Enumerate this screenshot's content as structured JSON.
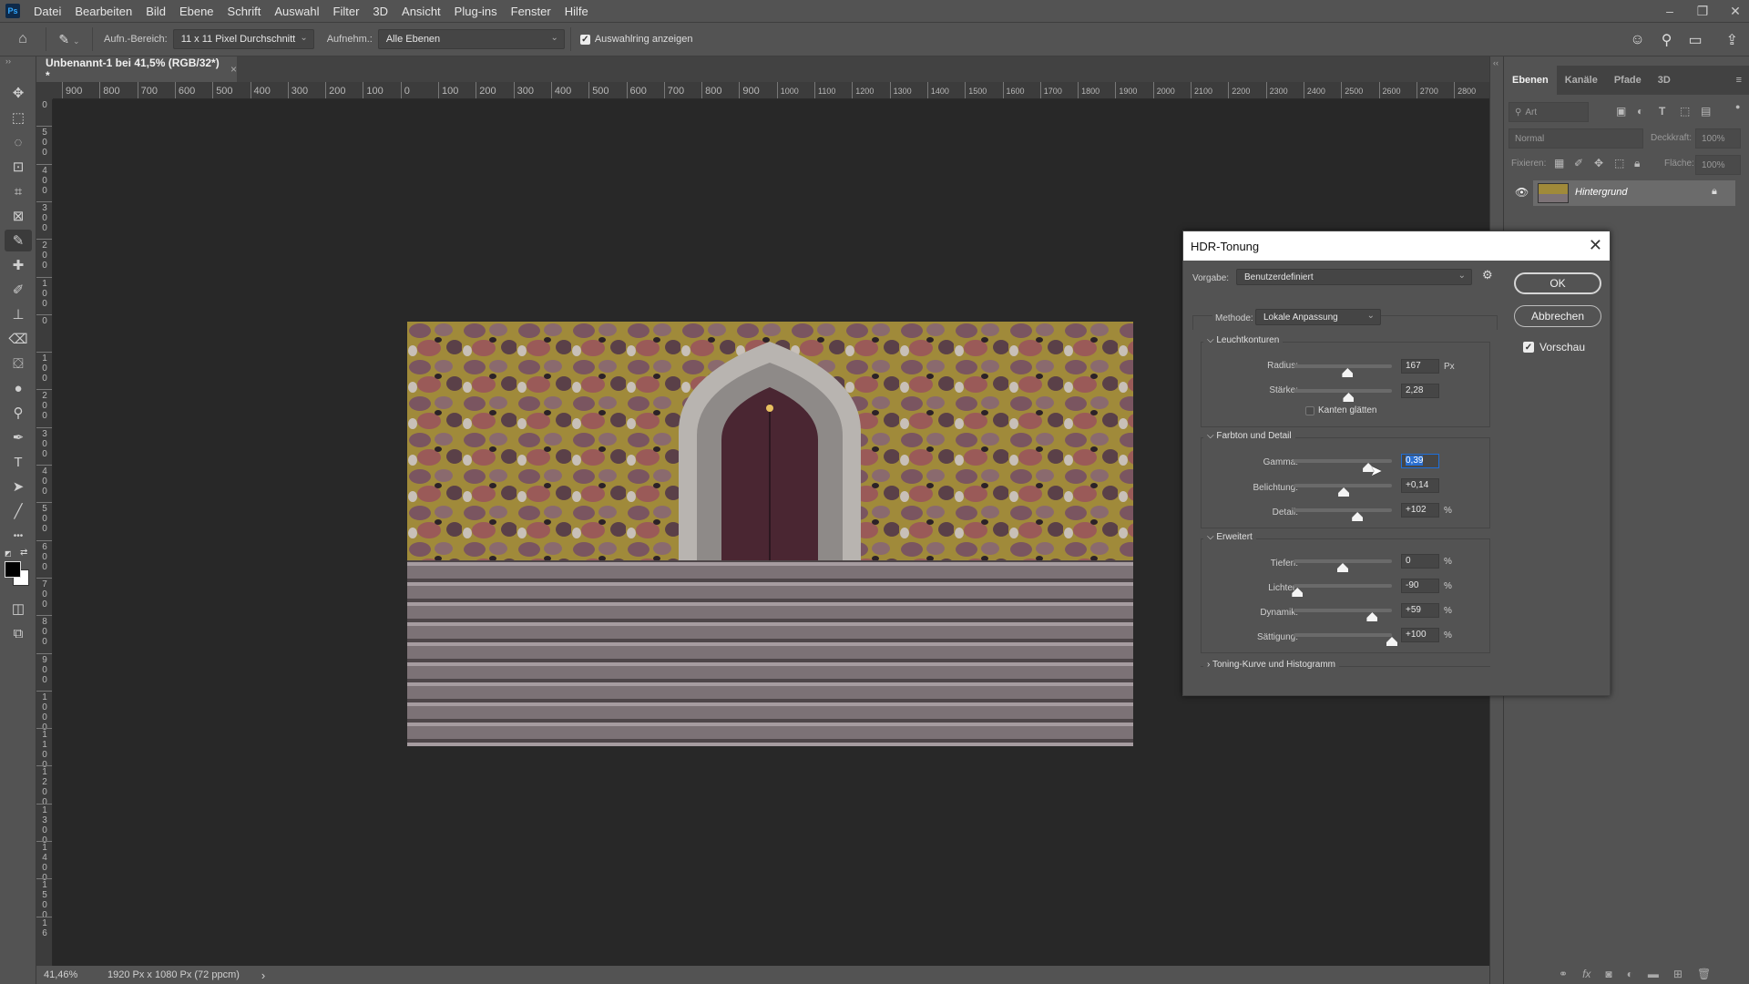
{
  "app": {
    "logo": "Ps"
  },
  "menu": [
    "Datei",
    "Bearbeiten",
    "Bild",
    "Ebene",
    "Schrift",
    "Auswahl",
    "Filter",
    "3D",
    "Ansicht",
    "Plug-ins",
    "Fenster",
    "Hilfe"
  ],
  "window_controls": {
    "minimize": "–",
    "restore": "❐",
    "close": "✕"
  },
  "options": {
    "sample_size_label": "Aufn.-Bereich:",
    "sample_size_value": "11 x 11 Pixel Durchschnitt",
    "sample_label": "Aufnehm.:",
    "sample_value": "Alle Ebenen",
    "show_ring_label": "Auswahlring anzeigen",
    "show_ring_checked": true
  },
  "document": {
    "tab_title": "Unbenannt-1 bei 41,5% (RGB/32*) *",
    "close": "×"
  },
  "ruler": {
    "horizontal": [
      "900",
      "800",
      "700",
      "600",
      "500",
      "400",
      "300",
      "200",
      "100",
      "0",
      "100",
      "200",
      "300",
      "400",
      "500",
      "600",
      "700",
      "800",
      "900",
      "1000",
      "1100",
      "1200",
      "1300",
      "1400",
      "1500",
      "1600",
      "1700",
      "1800",
      "1900",
      "2000",
      "2100",
      "2200",
      "2300",
      "2400",
      "2500",
      "2600",
      "2700",
      "2800"
    ],
    "vertical": [
      "0\n0",
      "5\n0\n0",
      "4\n0\n0",
      "3\n0\n0",
      "2\n0\n0",
      "1\n0\n0",
      "0",
      "1\n0\n0",
      "2\n0\n0",
      "3\n0\n0",
      "4\n0\n0",
      "5\n0\n0",
      "6\n0\n0",
      "7\n0\n0",
      "8\n0\n0",
      "9\n0\n0",
      "1\n0\n0\n0",
      "1\n1\n0\n0",
      "1\n2\n0\n0",
      "1\n3\n0\n0",
      "1\n4\n0\n0",
      "1\n5\n0\n0",
      "1\n6"
    ]
  },
  "status": {
    "zoom": "41,46%",
    "doc_info": "1920 Px x 1080 Px (72 ppcm)",
    "arrow": "›"
  },
  "tools": [
    {
      "name": "move-tool",
      "glyph": "✥"
    },
    {
      "name": "marquee-tool",
      "glyph": "⬚"
    },
    {
      "name": "lasso-tool",
      "glyph": "◌"
    },
    {
      "name": "object-select-tool",
      "glyph": "⊡"
    },
    {
      "name": "crop-tool",
      "glyph": "⌗"
    },
    {
      "name": "frame-tool",
      "glyph": "⊠"
    },
    {
      "name": "eyedropper-tool",
      "glyph": "✎"
    },
    {
      "name": "healing-brush-tool",
      "glyph": "✚"
    },
    {
      "name": "brush-tool",
      "glyph": "✐"
    },
    {
      "name": "stamp-tool",
      "glyph": "⊥"
    },
    {
      "name": "eraser-tool",
      "glyph": "⌫"
    },
    {
      "name": "paint-bucket-tool",
      "glyph": "⛋"
    },
    {
      "name": "blur-tool",
      "glyph": "●"
    },
    {
      "name": "dodge-tool",
      "glyph": "⚲"
    },
    {
      "name": "pen-tool",
      "glyph": "✒"
    },
    {
      "name": "type-tool",
      "glyph": "T"
    },
    {
      "name": "path-select-tool",
      "glyph": "➤"
    },
    {
      "name": "line-tool",
      "glyph": "╱"
    },
    {
      "name": "more-tools",
      "glyph": "•••"
    }
  ],
  "colors": {
    "foreground": "#000000",
    "background": "#ffffff",
    "accent": "#2a6fd0"
  },
  "panel": {
    "tabs": [
      "Ebenen",
      "Kanäle",
      "Pfade",
      "3D"
    ],
    "filter_placeholder": "Art",
    "blend_mode": "Normal",
    "opacity_label": "Deckkraft:",
    "opacity_value": "100%",
    "lock_label": "Fixieren:",
    "fill_label": "Fläche:",
    "fill_value": "100%",
    "layers": [
      {
        "name": "Hintergrund",
        "visible": true,
        "locked": true
      }
    ]
  },
  "dialog": {
    "title": "HDR-Tonung",
    "preset_label": "Vorgabe:",
    "preset_value": "Benutzerdefiniert",
    "method_label": "Methode:",
    "method_value": "Lokale Anpassung",
    "ok": "OK",
    "cancel": "Abbrechen",
    "preview_label": "Vorschau",
    "preview_checked": true,
    "sections": {
      "edge_glow": {
        "title": "Leuchtkonturen",
        "radius_label": "Radius:",
        "radius_value": "167",
        "radius_unit": "Px",
        "radius_pos": 0.55,
        "strength_label": "Stärke:",
        "strength_value": "2,28",
        "strength_pos": 0.56,
        "smooth_edges_label": "Kanten glätten",
        "smooth_edges_checked": false
      },
      "tone_detail": {
        "title": "Farbton und Detail",
        "gamma_label": "Gamma:",
        "gamma_value": "0,39",
        "gamma_pos": 0.76,
        "exposure_label": "Belichtung:",
        "exposure_value": "+0,14",
        "exposure_pos": 0.51,
        "detail_label": "Detail:",
        "detail_value": "+102",
        "detail_unit": "%",
        "detail_pos": 0.65
      },
      "advanced": {
        "title": "Erweitert",
        "shadow_label": "Tiefen:",
        "shadow_value": "0",
        "shadow_unit": "%",
        "shadow_pos": 0.5,
        "highlight_label": "Lichter:",
        "highlight_value": "-90",
        "highlight_unit": "%",
        "highlight_pos": 0.04,
        "vibrance_label": "Dynamik:",
        "vibrance_value": "+59",
        "vibrance_unit": "%",
        "vibrance_pos": 0.8,
        "saturation_label": "Sättigung:",
        "saturation_value": "+100",
        "saturation_unit": "%",
        "saturation_pos": 1.0
      },
      "curve": {
        "title": "Toning-Kurve und Histogramm"
      }
    }
  }
}
